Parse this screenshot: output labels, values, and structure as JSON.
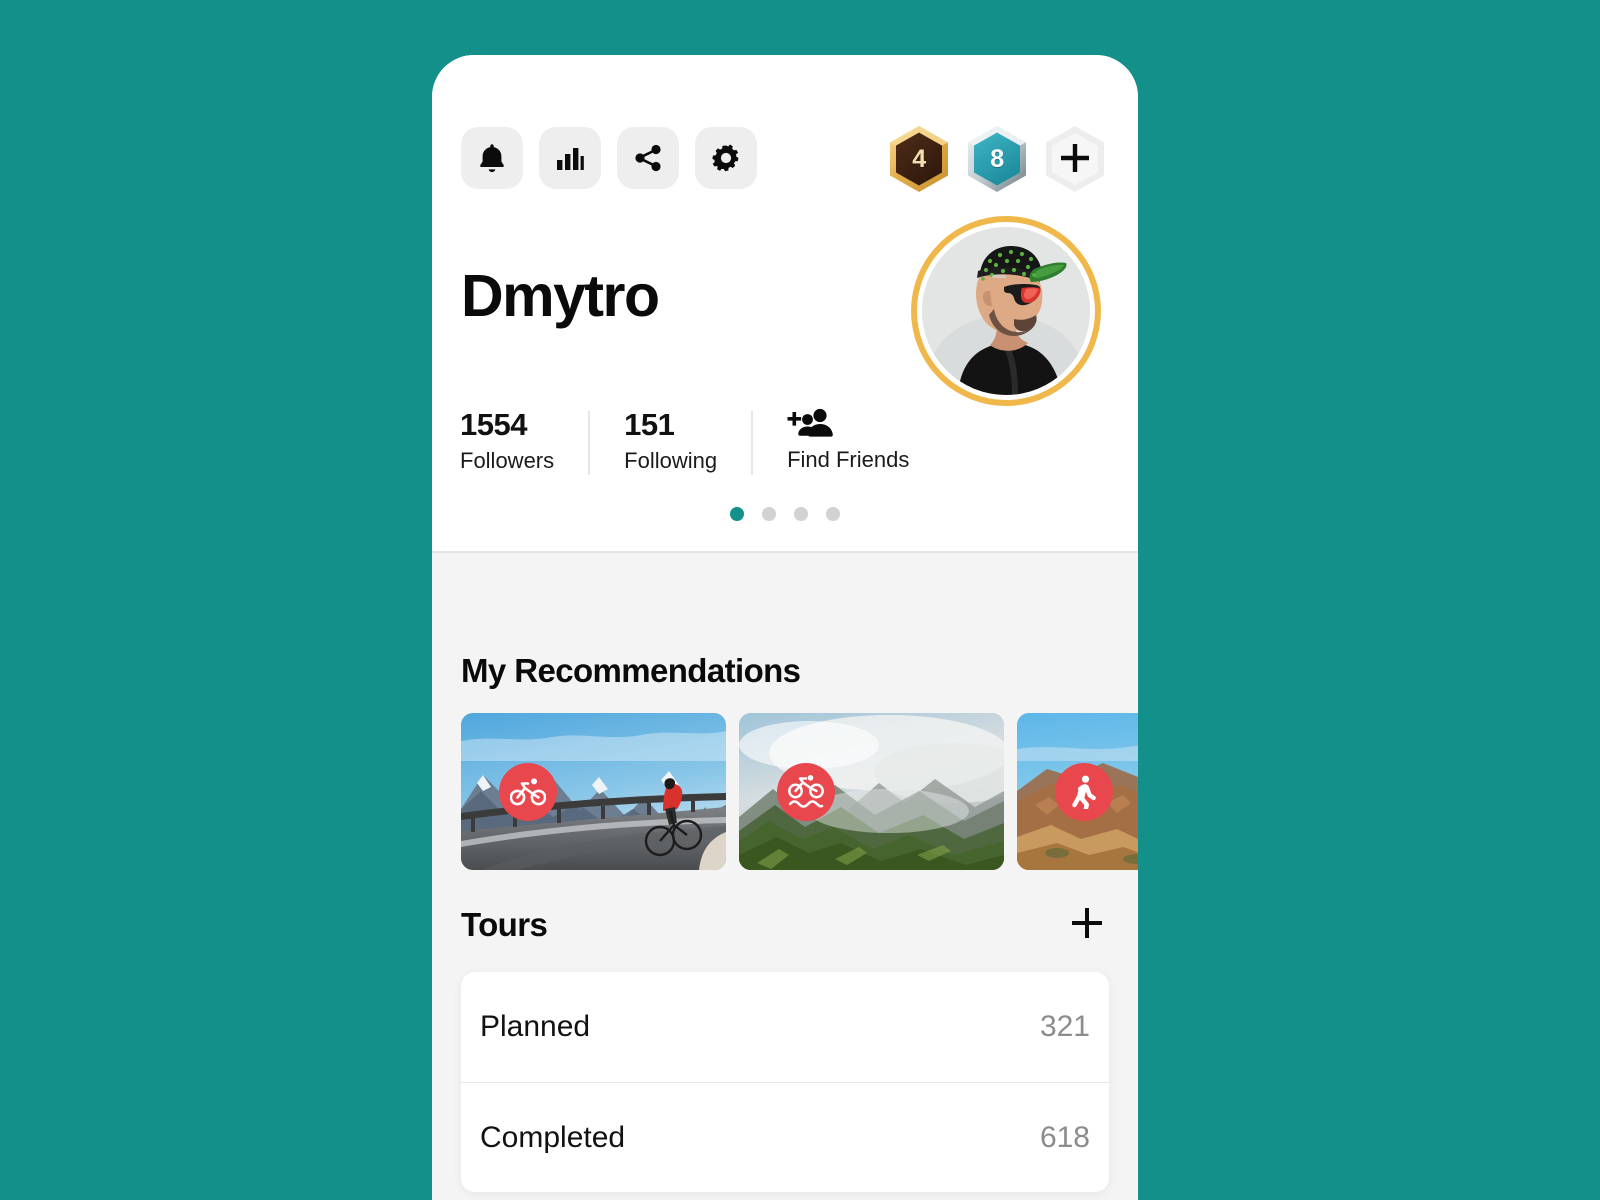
{
  "theme": {
    "background": "#139089",
    "accent_teal": "#12908a",
    "sport_badge_red": "#e8474d",
    "avatar_ring": "#f0b74b",
    "card_bg": "#ffffff",
    "body_bg": "#f4f4f4"
  },
  "toolbar": {
    "items": [
      {
        "name": "notifications-icon",
        "label": "Notifications"
      },
      {
        "name": "statistics-icon",
        "label": "Statistics"
      },
      {
        "name": "share-icon",
        "label": "Share"
      },
      {
        "name": "settings-icon",
        "label": "Settings"
      }
    ]
  },
  "badges": [
    {
      "name": "gold-badge",
      "value": "4",
      "style": "gold"
    },
    {
      "name": "silver-badge",
      "value": "8",
      "style": "silver"
    },
    {
      "name": "add-badge",
      "value": "+",
      "style": "empty"
    }
  ],
  "profile": {
    "name": "Dmytro",
    "avatar_alt": "cyclist-profile-photo"
  },
  "stats": {
    "followers": {
      "value": "1554",
      "label": "Followers"
    },
    "following": {
      "value": "151",
      "label": "Following"
    },
    "find_friends": {
      "label": "Find Friends",
      "icon": "add-people-icon"
    }
  },
  "pagination": {
    "count": 4,
    "active_index": 0
  },
  "recommendations": {
    "title": "My Recommendations",
    "cards": [
      {
        "name": "recommendation-card-road-cycling",
        "sport": "road-cycling-icon",
        "scene": "cyclist-in-red-jacket-on-alpine-mountain-road"
      },
      {
        "name": "recommendation-card-mountain-biking",
        "sport": "mountain-biking-icon",
        "scene": "green-misty-mountain-ridges"
      },
      {
        "name": "recommendation-card-hiking",
        "sport": "hiking-icon",
        "scene": "desert-canyon-rock-formations"
      }
    ]
  },
  "tours": {
    "title": "Tours",
    "add_label": "+",
    "rows": [
      {
        "label": "Planned",
        "count": "321"
      },
      {
        "label": "Completed",
        "count": "618"
      }
    ]
  }
}
